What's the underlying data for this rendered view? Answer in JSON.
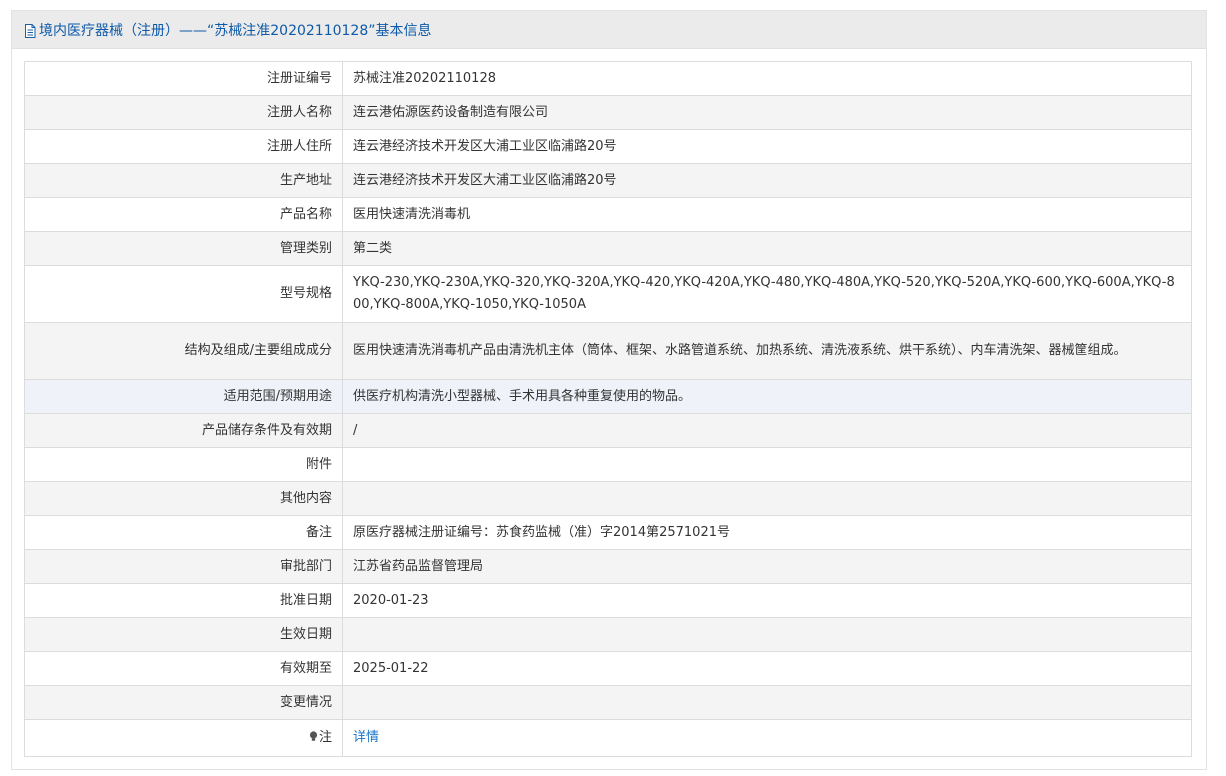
{
  "header": {
    "title": "境内医疗器械（注册）——“苏械注准20202110128”基本信息",
    "icon": "document-icon"
  },
  "rows": [
    {
      "label": "注册证编号",
      "value": "苏械注准20202110128"
    },
    {
      "label": "注册人名称",
      "value": "连云港佑源医药设备制造有限公司"
    },
    {
      "label": "注册人住所",
      "value": "连云港经济技术开发区大浦工业区临浦路20号"
    },
    {
      "label": "生产地址",
      "value": "连云港经济技术开发区大浦工业区临浦路20号"
    },
    {
      "label": "产品名称",
      "value": "医用快速清洗消毒机"
    },
    {
      "label": "管理类别",
      "value": "第二类"
    },
    {
      "label": "型号规格",
      "value": "YKQ-230,YKQ-230A,YKQ-320,YKQ-320A,YKQ-420,YKQ-420A,YKQ-480,YKQ-480A,YKQ-520,YKQ-520A,YKQ-600,YKQ-600A,YKQ-800,YKQ-800A,YKQ-1050,YKQ-1050A"
    },
    {
      "label": "结构及组成/主要组成成分",
      "value": "医用快速清洗消毒机产品由清洗机主体（筒体、框架、水路管道系统、加热系统、清洗液系统、烘干系统）、内车清洗架、器械筐组成。"
    },
    {
      "label": "适用范围/预期用途",
      "value": "供医疗机构清洗小型器械、手术用具各种重复使用的物品。"
    },
    {
      "label": "产品储存条件及有效期",
      "value": "/"
    },
    {
      "label": "附件",
      "value": ""
    },
    {
      "label": "其他内容",
      "value": ""
    },
    {
      "label": "备注",
      "value": "原医疗器械注册证编号：苏食药监械（准）字2014第2571021号"
    },
    {
      "label": "审批部门",
      "value": "江苏省药品监督管理局"
    },
    {
      "label": "批准日期",
      "value": "2020-01-23"
    },
    {
      "label": "生效日期",
      "value": ""
    },
    {
      "label": "有效期至",
      "value": "2025-01-22"
    },
    {
      "label": "变更情况",
      "value": ""
    }
  ],
  "note": {
    "label": "注",
    "icon": "lightbulb-icon",
    "link_label": "详情"
  },
  "colors": {
    "title": "#0e5aa8",
    "link": "#1a73c8",
    "header_bg": "#ebebeb",
    "row_alt": "#f4f4f4",
    "row_highlight": "#eff3f9",
    "border": "#dcdcdc"
  }
}
